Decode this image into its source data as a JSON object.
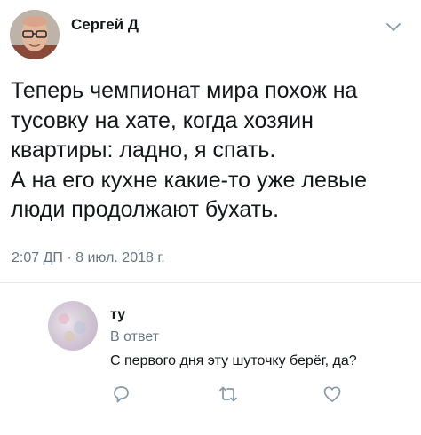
{
  "tweet": {
    "author_name": "Сергей Д",
    "text_lines": [
      "Теперь чемпионат мира похож на",
      "тусовку на хате, когда хозяин",
      "квартиры: ладно, я спать.",
      "А на его кухне какие-то уже левые",
      "люди продолжают бухать."
    ],
    "timestamp": "2:07 ДП · 8 июл. 2018 г."
  },
  "reply": {
    "author_name": "ту",
    "context": "В ответ",
    "text": "С первого дня эту шуточку берёг, да?"
  },
  "icons": {
    "menu": "chevron-down-icon",
    "reply": "comment-icon",
    "retweet": "retweet-icon",
    "like": "heart-icon"
  },
  "colors": {
    "text": "#14171a",
    "secondary": "#657786",
    "icon": "#8899a6",
    "divider": "#e6ecf0"
  }
}
